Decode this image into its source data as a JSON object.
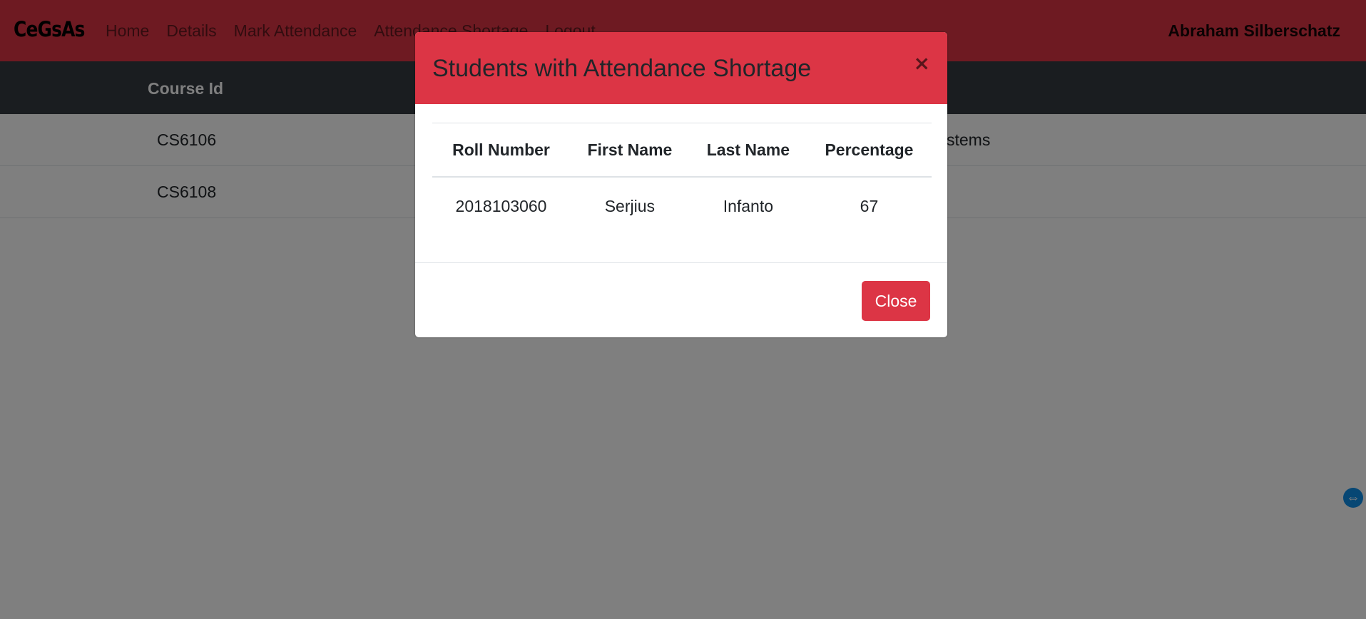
{
  "navbar": {
    "brand": "CeGsAs",
    "links": [
      "Home",
      "Details",
      "Mark Attendance",
      "Attendance Shortage",
      "Logout"
    ],
    "user": "Abraham Silberschatz"
  },
  "course_table": {
    "header": "Course Id",
    "rows": [
      {
        "id": "CS6106",
        "name_fragment": "stems"
      },
      {
        "id": "CS6108",
        "name_fragment": ""
      }
    ]
  },
  "modal": {
    "title": "Students with Attendance Shortage",
    "close_symbol": "×",
    "columns": [
      "Roll Number",
      "First Name",
      "Last Name",
      "Percentage"
    ],
    "rows": [
      {
        "roll": "2018103060",
        "first": "Serjius",
        "last": "Infanto",
        "percentage": "67"
      }
    ],
    "close_button": "Close"
  },
  "side_widget": {
    "icon": "teamviewer-icon",
    "glyph": "⇔"
  },
  "colors": {
    "primary": "#dc3545",
    "dark": "#343a40",
    "backdrop": "rgba(0,0,0,0.5)"
  }
}
